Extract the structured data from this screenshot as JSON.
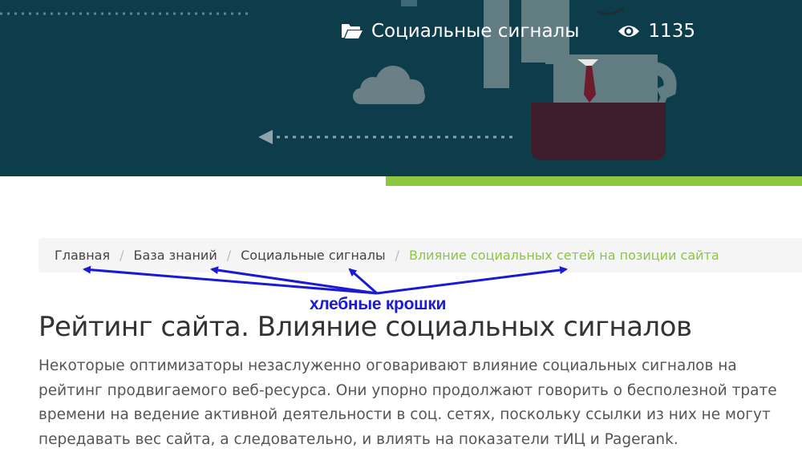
{
  "hero": {
    "category": "Социальные сигналы",
    "views": "1135",
    "colors": {
      "background": "#0d3d4a",
      "accent": "#8dc63f"
    }
  },
  "breadcrumb": {
    "items": [
      {
        "label": "Главная"
      },
      {
        "label": "База знаний"
      },
      {
        "label": "Социальные сигналы"
      }
    ],
    "separator": "/",
    "current": "Влияние социальных сетей на позиции сайта"
  },
  "annotation": {
    "label": "хлебные крошки",
    "color": "#1a1ad4"
  },
  "article": {
    "title": "Рейтинг сайта. Влияние социальных сигналов",
    "paragraph": "Некоторые оптимизаторы незаслуженно оговаривают влияние социальных сигналов на рейтинг продвигаемого веб-ресурса. Они упорно продолжают говорить о бесполезной трате времени на ведение активной деятельности в соц. сетях, поскольку ссылки из них не могут передавать вес сайта, а следовательно, и влиять на показатели тИЦ и Pagerank."
  }
}
